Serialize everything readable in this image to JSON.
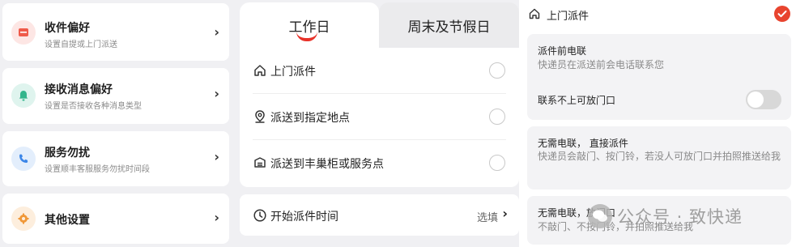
{
  "left": {
    "items": [
      {
        "title": "收件偏好",
        "subtitle": "设置自提或上门派送",
        "icon": "package-icon",
        "icon_bg": "#fde6e4",
        "icon_color": "#ef5a4a"
      },
      {
        "title": "接收消息偏好",
        "subtitle": "设置是否接收各种消息类型",
        "icon": "bell-icon",
        "icon_bg": "#dff4ee",
        "icon_color": "#34b58c"
      },
      {
        "title": "服务勿扰",
        "subtitle": "设置顺丰客服服务勿扰时间段",
        "icon": "phone-icon",
        "icon_bg": "#e3eefc",
        "icon_color": "#3c86e8"
      },
      {
        "title": "其他设置",
        "subtitle": "",
        "icon": "gear-icon",
        "icon_bg": "#fdeedd",
        "icon_color": "#f09838"
      }
    ]
  },
  "middle": {
    "tabs": [
      {
        "label": "工作日"
      },
      {
        "label": "周末及节假日"
      }
    ],
    "options": [
      {
        "label": "上门派件",
        "icon": "home-icon"
      },
      {
        "label": "派送到指定地点",
        "icon": "location-pin-icon"
      },
      {
        "label": "派送到丰巢柜或服务点",
        "icon": "locker-icon"
      }
    ],
    "time_row": {
      "label": "开始派件时间",
      "select_label": "选填"
    }
  },
  "right": {
    "header_title": "上门派件",
    "cards": [
      {
        "title": "派件前电联",
        "desc": "快递员在派送前会电话联系您",
        "toggle_label": "联系不上可放门口",
        "toggle_on": false
      },
      {
        "title": "无需电联， 直接派件",
        "desc": "快递员会敲门、按门铃，若没人可放门口并拍照推送给我"
      },
      {
        "title": "无需电联，放门口",
        "desc": "不敲门、不按门铃，并拍照推送给我"
      }
    ]
  },
  "watermark": {
    "text": "公众号 · 致快递"
  },
  "colors": {
    "accent": "#e8332a",
    "check": "#e8442f"
  }
}
